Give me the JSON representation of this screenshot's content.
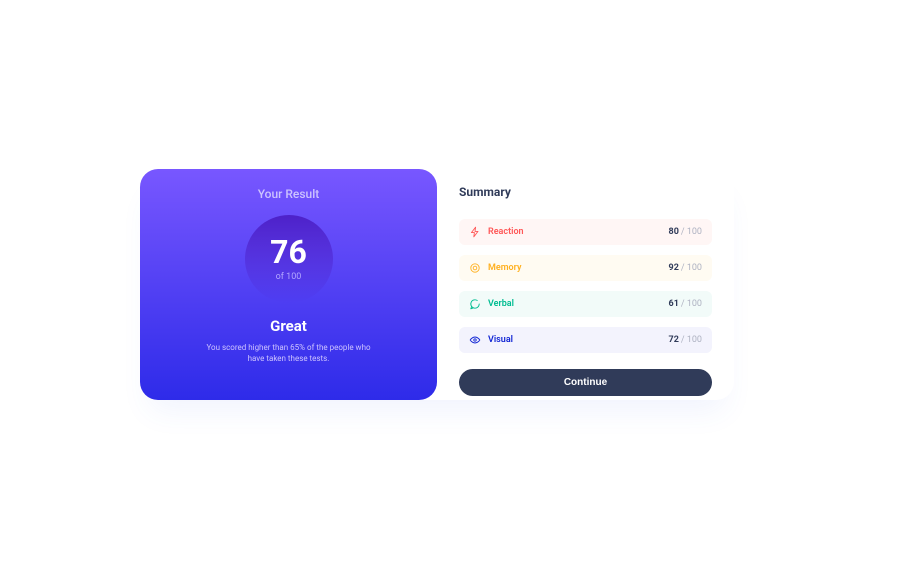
{
  "colors": {
    "gradient_top": "#7857FF",
    "gradient_bottom": "#2E2BE9",
    "reaction": "#FF5757",
    "memory": "#FFB01F",
    "verbal": "#00BD91",
    "visual": "#1125D4",
    "button_bg": "#303B59"
  },
  "result": {
    "heading": "Your Result",
    "score": "76",
    "of_max": "of 100",
    "rank": "Great",
    "description": "You scored higher than 65% of the people who have taken these tests."
  },
  "summary": {
    "heading": "Summary",
    "max_label": "/ 100",
    "items": [
      {
        "key": "reaction",
        "name": "Reaction",
        "value": "80",
        "icon": "bolt-icon"
      },
      {
        "key": "memory",
        "name": "Memory",
        "value": "92",
        "icon": "brain-icon"
      },
      {
        "key": "verbal",
        "name": "Verbal",
        "value": "61",
        "icon": "chat-icon"
      },
      {
        "key": "visual",
        "name": "Visual",
        "value": "72",
        "icon": "eye-icon"
      }
    ],
    "continue": "Continue"
  }
}
